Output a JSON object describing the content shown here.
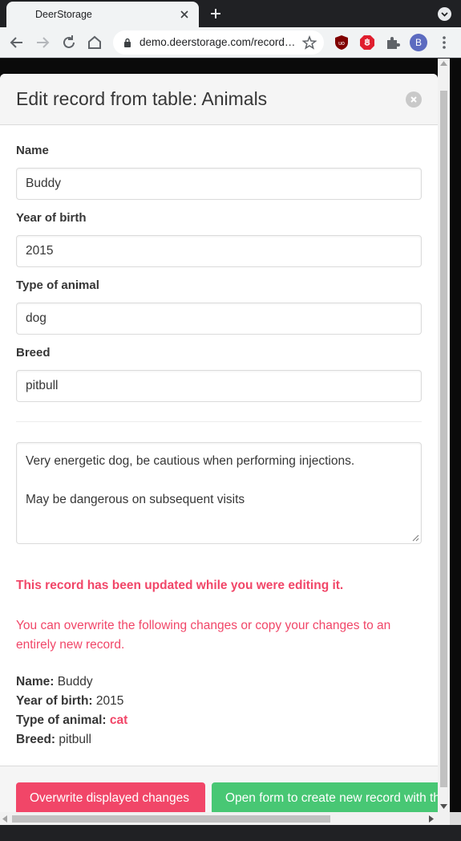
{
  "browser": {
    "tab_title": "DeerStorage",
    "url": "demo.deerstorage.com/records/...",
    "avatar_initial": "B"
  },
  "modal": {
    "title": "Edit record from table: Animals",
    "fields": [
      {
        "label": "Name",
        "value": "Buddy"
      },
      {
        "label": "Year of birth",
        "value": "2015"
      },
      {
        "label": "Type of animal",
        "value": "dog"
      },
      {
        "label": "Breed",
        "value": "pitbull"
      }
    ],
    "notes_line1": "Very energetic dog, be cautious when performing injections.",
    "notes_line2": "May be dangerous on subsequent visits",
    "warning_title": "This record has been updated while you were editing it.",
    "warning_text": "You can overwrite the following changes or copy your changes to an entirely new record.",
    "changes": [
      {
        "label": "Name:",
        "value": "Buddy",
        "changed": false
      },
      {
        "label": "Year of birth:",
        "value": "2015",
        "changed": false
      },
      {
        "label": "Type of animal:",
        "value": "cat",
        "changed": true
      },
      {
        "label": "Breed:",
        "value": "pitbull",
        "changed": false
      }
    ],
    "overwrite_button": "Overwrite displayed changes",
    "new_record_button": "Open form to create new record with these values"
  },
  "colors": {
    "danger": "#f14668",
    "success": "#48c774",
    "text": "#363636"
  },
  "icons": [
    "close-icon",
    "plus-icon",
    "back-icon",
    "forward-icon",
    "reload-icon",
    "home-icon",
    "lock-icon",
    "star-icon",
    "ublock-icon",
    "adblock-icon",
    "puzzle-icon",
    "kebab-menu-icon"
  ]
}
